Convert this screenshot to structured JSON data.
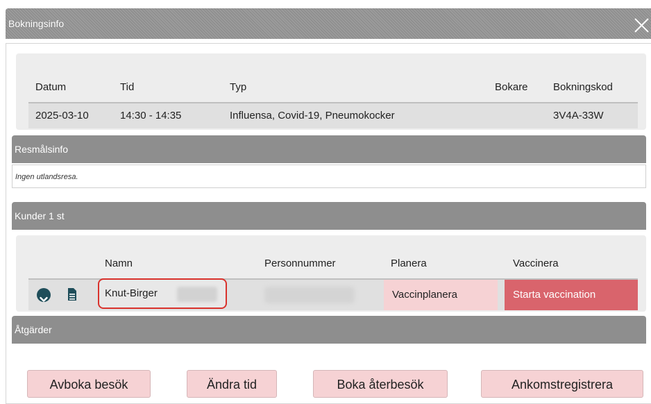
{
  "dialog": {
    "title": "Bokningsinfo",
    "close_icon": "close-icon"
  },
  "booking": {
    "headers": {
      "datum": "Datum",
      "tid": "Tid",
      "typ": "Typ",
      "bokare": "Bokare",
      "bokningskod": "Bokningskod"
    },
    "row": {
      "datum": "2025-03-10",
      "tid": "14:30 - 14:35",
      "typ": "Influensa, Covid-19, Pneumokocker",
      "bokare": "",
      "bokningskod": "3V4A-33W"
    }
  },
  "resmalsinfo": {
    "header": "Resmålsinfo",
    "note": "Ingen utlandsresa."
  },
  "kunder": {
    "header": "Kunder 1 st",
    "columns": {
      "namn": "Namn",
      "personnummer": "Personnummer",
      "planera": "Planera",
      "vaccinera": "Vaccinera"
    },
    "row": {
      "expand_icon": "chevron-down-icon",
      "document_icon": "document-icon",
      "name": "Knut-Birger",
      "plan_action": "Vaccinplanera",
      "vaccinate_action": "Starta vaccination"
    }
  },
  "atgarder": {
    "header": "Åtgärder",
    "buttons": {
      "avboka": "Avboka besök",
      "andra_tid": "Ändra tid",
      "boka_aterbesok": "Boka återbesök",
      "ankomst": "Ankomstregistrera"
    }
  },
  "colors": {
    "section_header_bg": "#8e8e8e",
    "action_pink": "#f6d2d4",
    "vaccinate_red": "#d9646c",
    "highlight_outline": "#d9322c",
    "chevron_dark": "#1f4e5a"
  }
}
